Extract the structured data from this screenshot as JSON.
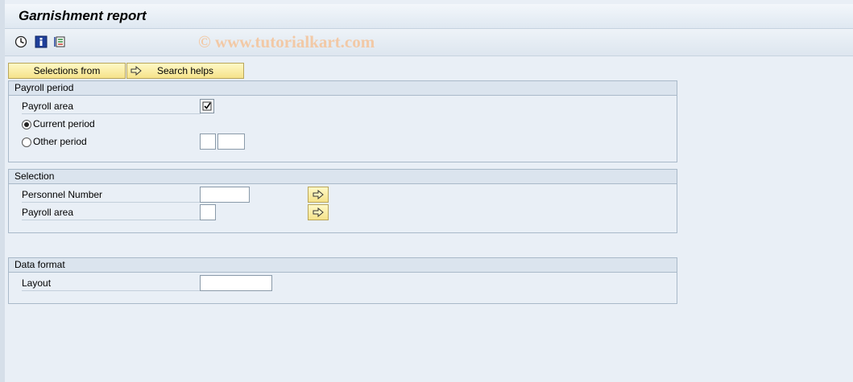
{
  "window": {
    "title": "Garnishment report"
  },
  "toolbar": {
    "icons": [
      "execute-icon",
      "info-icon",
      "get-variant-icon"
    ],
    "watermark": "© www.tutorialkart.com"
  },
  "buttons": {
    "selections_from": "Selections from",
    "search_helps": "Search helps"
  },
  "payroll_period": {
    "title": "Payroll period",
    "payroll_area_label": "Payroll area",
    "payroll_area_checked": true,
    "current_period_label": "Current period",
    "other_period_label": "Other period",
    "selected_option": "current"
  },
  "selection": {
    "title": "Selection",
    "personnel_number_label": "Personnel Number",
    "personnel_number_value": "",
    "payroll_area_label": "Payroll area",
    "payroll_area_value": ""
  },
  "data_format": {
    "title": "Data format",
    "layout_label": "Layout",
    "layout_value": ""
  },
  "colors": {
    "background": "#e9eff6",
    "button_yellow": "#f5e28a",
    "watermark": "#f2c9a6"
  }
}
